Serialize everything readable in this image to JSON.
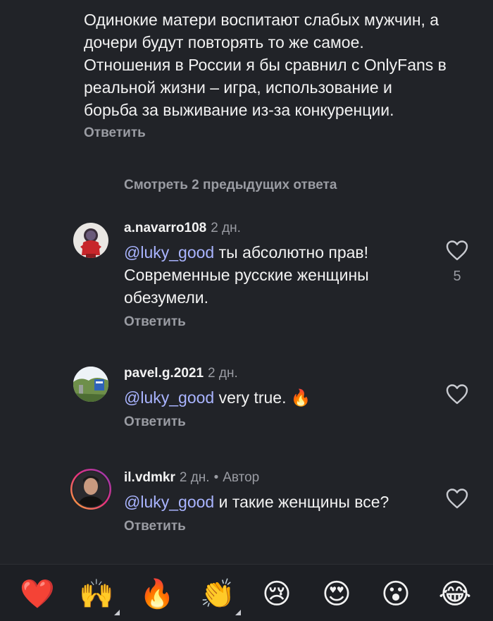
{
  "top_comment": {
    "text": "Одинокие матери воспитают слабых мужчин, а дочери будут повторять то же самое. Отношения в России я бы сравнил с OnlyFans в реальной жизни – игра, использование и борьба за выживание из-за конкуренции.",
    "reply_label": "Ответить"
  },
  "view_previous_label": "Смотреть 2 предыдущих ответа",
  "comments": [
    {
      "username": "a.navarro108",
      "time": "2 дн.",
      "mention": "@luky_good",
      "text": " ты абсолютно прав! Современные русские женщины обезумели.",
      "reply_label": "Ответить",
      "like_count": "5",
      "avatar_icon": "astronaut-avatar"
    },
    {
      "username": "pavel.g.2021",
      "time": "2 дн.",
      "mention": "@luky_good",
      "text": " very true. 🔥",
      "reply_label": "Ответить",
      "like_count": "",
      "avatar_icon": "landscape-avatar"
    },
    {
      "username": "il.vdmkr",
      "time": "2 дн.",
      "dot": "•",
      "author_badge": "Автор",
      "mention": "@luky_good",
      "text": " и такие женщины все?",
      "reply_label": "Ответить",
      "like_count": "",
      "avatar_icon": "person-avatar"
    }
  ],
  "emoji_bar": [
    {
      "emoji": "❤️",
      "name": "red-heart"
    },
    {
      "emoji": "🙌",
      "name": "raising-hands"
    },
    {
      "emoji": "🔥",
      "name": "fire"
    },
    {
      "emoji": "👏",
      "name": "clapping-hands"
    },
    {
      "emoji": "😢",
      "name": "crying-face"
    },
    {
      "emoji": "😍",
      "name": "heart-eyes-face"
    },
    {
      "emoji": "😮",
      "name": "surprised-face"
    },
    {
      "emoji": "😂",
      "name": "tears-of-joy-face"
    }
  ],
  "colors": {
    "background": "#212328",
    "text": "#f2f2f2",
    "muted": "#9a9ca3",
    "mention": "#a9b4ff"
  }
}
